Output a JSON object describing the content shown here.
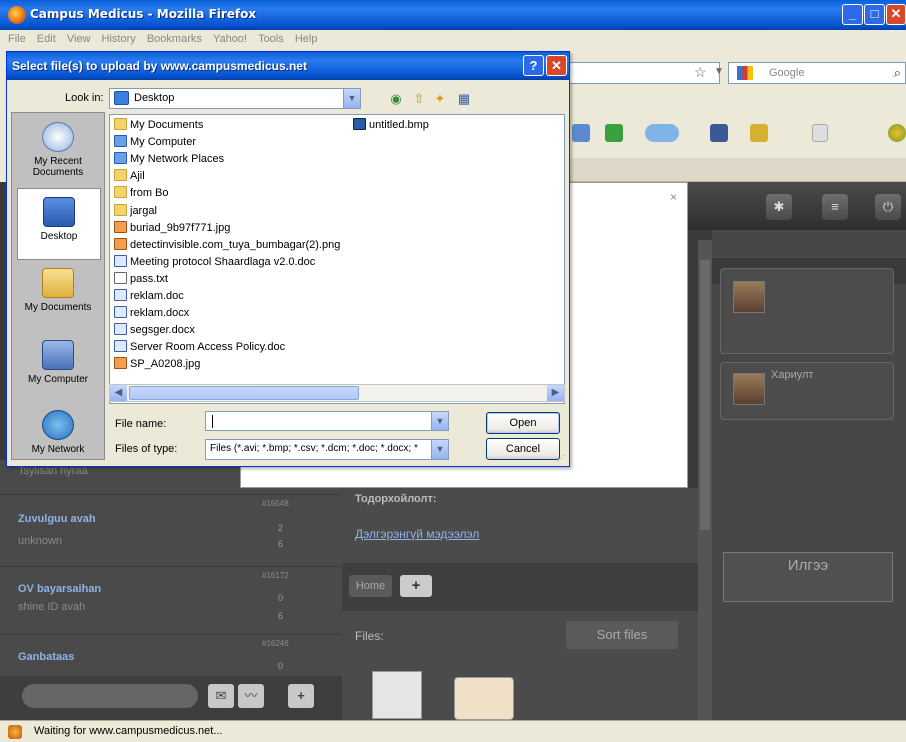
{
  "browser": {
    "title": "Campus Medicus - Mozilla Firefox",
    "menu": [
      "File",
      "Edit",
      "View",
      "History",
      "Bookmarks",
      "Yahoo!",
      "Tools",
      "Help"
    ],
    "search_placeholder": "Google",
    "status": "Waiting for www.campusmedicus.net..."
  },
  "dialog": {
    "title": "Select file(s) to upload by www.campusmedicus.net",
    "help": "?",
    "close": "✕",
    "look_in_label": "Look in:",
    "look_in_value": "Desktop",
    "places": [
      {
        "label": "My Recent Documents",
        "icon": "recent-documents-icon"
      },
      {
        "label": "Desktop",
        "icon": "desktop-icon"
      },
      {
        "label": "My Documents",
        "icon": "my-documents-icon"
      },
      {
        "label": "My Computer",
        "icon": "my-computer-icon"
      },
      {
        "label": "My Network",
        "icon": "my-network-icon"
      }
    ],
    "files_col1": [
      {
        "name": "My Documents",
        "type": "folder"
      },
      {
        "name": "My Computer",
        "type": "sys"
      },
      {
        "name": "My Network Places",
        "type": "sys"
      },
      {
        "name": "Ajil",
        "type": "folder"
      },
      {
        "name": "from Bo",
        "type": "folder"
      },
      {
        "name": "jargal",
        "type": "folder"
      },
      {
        "name": "buriad_9b97f771.jpg",
        "type": "img"
      },
      {
        "name": "detectinvisible.com_tuya_bumbagar(2).png",
        "type": "img"
      },
      {
        "name": "Meeting protocol Shaardlaga v2.0.doc",
        "type": "doc"
      },
      {
        "name": "pass.txt",
        "type": "txt"
      },
      {
        "name": "reklam.doc",
        "type": "doc"
      },
      {
        "name": "reklam.docx",
        "type": "doc"
      },
      {
        "name": "segsger.docx",
        "type": "doc"
      },
      {
        "name": "Server Room Access Policy.doc",
        "type": "doc"
      },
      {
        "name": "SP_A0208.jpg",
        "type": "img"
      }
    ],
    "files_col2": [
      {
        "name": "untitled.bmp",
        "type": "bmp"
      }
    ],
    "file_name_label": "File name:",
    "file_name_value": "",
    "files_of_type_label": "Files of type:",
    "files_of_type_value": "Files (*.avi; *.bmp; *.csv; *.dcm; *.doc; *.docx; *",
    "open_label": "Open",
    "cancel_label": "Cancel"
  },
  "page": {
    "modal_close": "×",
    "left_items": [
      {
        "name": "Zuvulguu avah",
        "sub": "unknown",
        "id": "#16548",
        "count_a": "2",
        "count_b": "6"
      },
      {
        "name": "OV bayarsaihan",
        "sub": "shine ID avah",
        "id": "#16172",
        "count_a": "0",
        "count_b": "6"
      },
      {
        "name": "Ganbataas",
        "sub": "",
        "id": "#16246",
        "count_a": "0",
        "count_b": ""
      }
    ],
    "left_partial": "Tsylisan nyraa",
    "todorh": "Тодорхойлолт:",
    "link": "Дэлгэрэнгүй мэдээлэл",
    "home": "Home",
    "files_label": "Files:",
    "sort_files": "Sort files",
    "card2_name": "Хариулт",
    "ilgee": "Илгээ"
  }
}
